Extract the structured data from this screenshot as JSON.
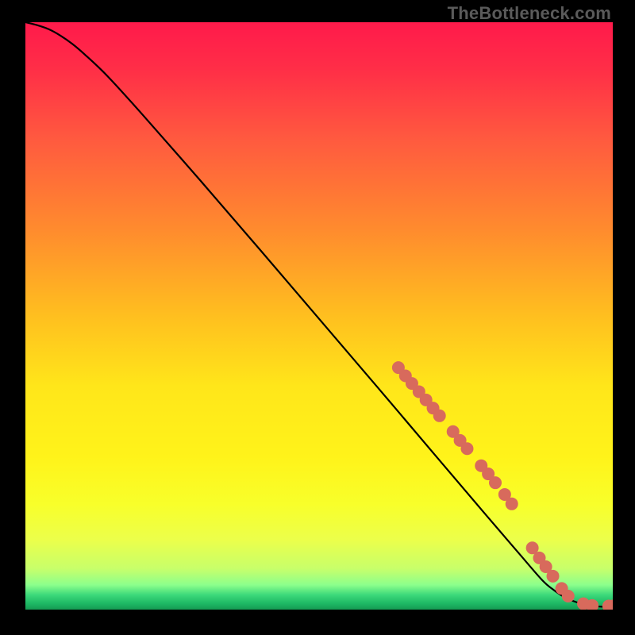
{
  "watermark": "TheBottleneck.com",
  "chart_data": {
    "type": "line",
    "title": "",
    "xlabel": "",
    "ylabel": "",
    "xlim": [
      0,
      100
    ],
    "ylim": [
      0,
      100
    ],
    "gradient_stops": [
      {
        "offset": 0.0,
        "color": "#ff1a4b"
      },
      {
        "offset": 0.08,
        "color": "#ff2e47"
      },
      {
        "offset": 0.2,
        "color": "#ff5a3f"
      },
      {
        "offset": 0.35,
        "color": "#ff8a2e"
      },
      {
        "offset": 0.5,
        "color": "#ffbf1f"
      },
      {
        "offset": 0.62,
        "color": "#ffe61a"
      },
      {
        "offset": 0.74,
        "color": "#fff31a"
      },
      {
        "offset": 0.82,
        "color": "#f8ff2a"
      },
      {
        "offset": 0.88,
        "color": "#ecff4a"
      },
      {
        "offset": 0.93,
        "color": "#c8ff6a"
      },
      {
        "offset": 0.958,
        "color": "#8cff8c"
      },
      {
        "offset": 0.975,
        "color": "#3cd97a"
      },
      {
        "offset": 0.99,
        "color": "#1db864"
      },
      {
        "offset": 1.0,
        "color": "#159a52"
      }
    ],
    "series": [
      {
        "name": "curve",
        "color": "#000000",
        "x": [
          0,
          2,
          4,
          6,
          8,
          10,
          14,
          20,
          30,
          40,
          50,
          60,
          70,
          78,
          84,
          88,
          90,
          92,
          94,
          96,
          98,
          100
        ],
        "y": [
          100,
          99.5,
          98.8,
          97.7,
          96.3,
          94.6,
          90.8,
          84.2,
          72.8,
          61.2,
          49.5,
          37.8,
          26.0,
          16.6,
          9.6,
          5.0,
          3.3,
          2.0,
          1.2,
          0.7,
          0.5,
          0.5
        ]
      }
    ],
    "markers": {
      "color": "#d86a5c",
      "radius": 8,
      "points": [
        {
          "x": 63.5,
          "y": 41.2
        },
        {
          "x": 64.7,
          "y": 39.8
        },
        {
          "x": 65.8,
          "y": 38.5
        },
        {
          "x": 67.0,
          "y": 37.1
        },
        {
          "x": 68.2,
          "y": 35.7
        },
        {
          "x": 69.4,
          "y": 34.3
        },
        {
          "x": 70.5,
          "y": 33.0
        },
        {
          "x": 72.8,
          "y": 30.3
        },
        {
          "x": 74.0,
          "y": 28.8
        },
        {
          "x": 75.2,
          "y": 27.4
        },
        {
          "x": 77.6,
          "y": 24.5
        },
        {
          "x": 78.8,
          "y": 23.1
        },
        {
          "x": 80.0,
          "y": 21.6
        },
        {
          "x": 81.6,
          "y": 19.6
        },
        {
          "x": 82.8,
          "y": 18.0
        },
        {
          "x": 86.3,
          "y": 10.5
        },
        {
          "x": 87.5,
          "y": 8.8
        },
        {
          "x": 88.6,
          "y": 7.3
        },
        {
          "x": 89.8,
          "y": 5.7
        },
        {
          "x": 91.3,
          "y": 3.6
        },
        {
          "x": 92.4,
          "y": 2.3
        },
        {
          "x": 95.0,
          "y": 1.0
        },
        {
          "x": 96.5,
          "y": 0.7
        },
        {
          "x": 99.3,
          "y": 0.6
        },
        {
          "x": 100.0,
          "y": 0.6
        }
      ]
    }
  }
}
